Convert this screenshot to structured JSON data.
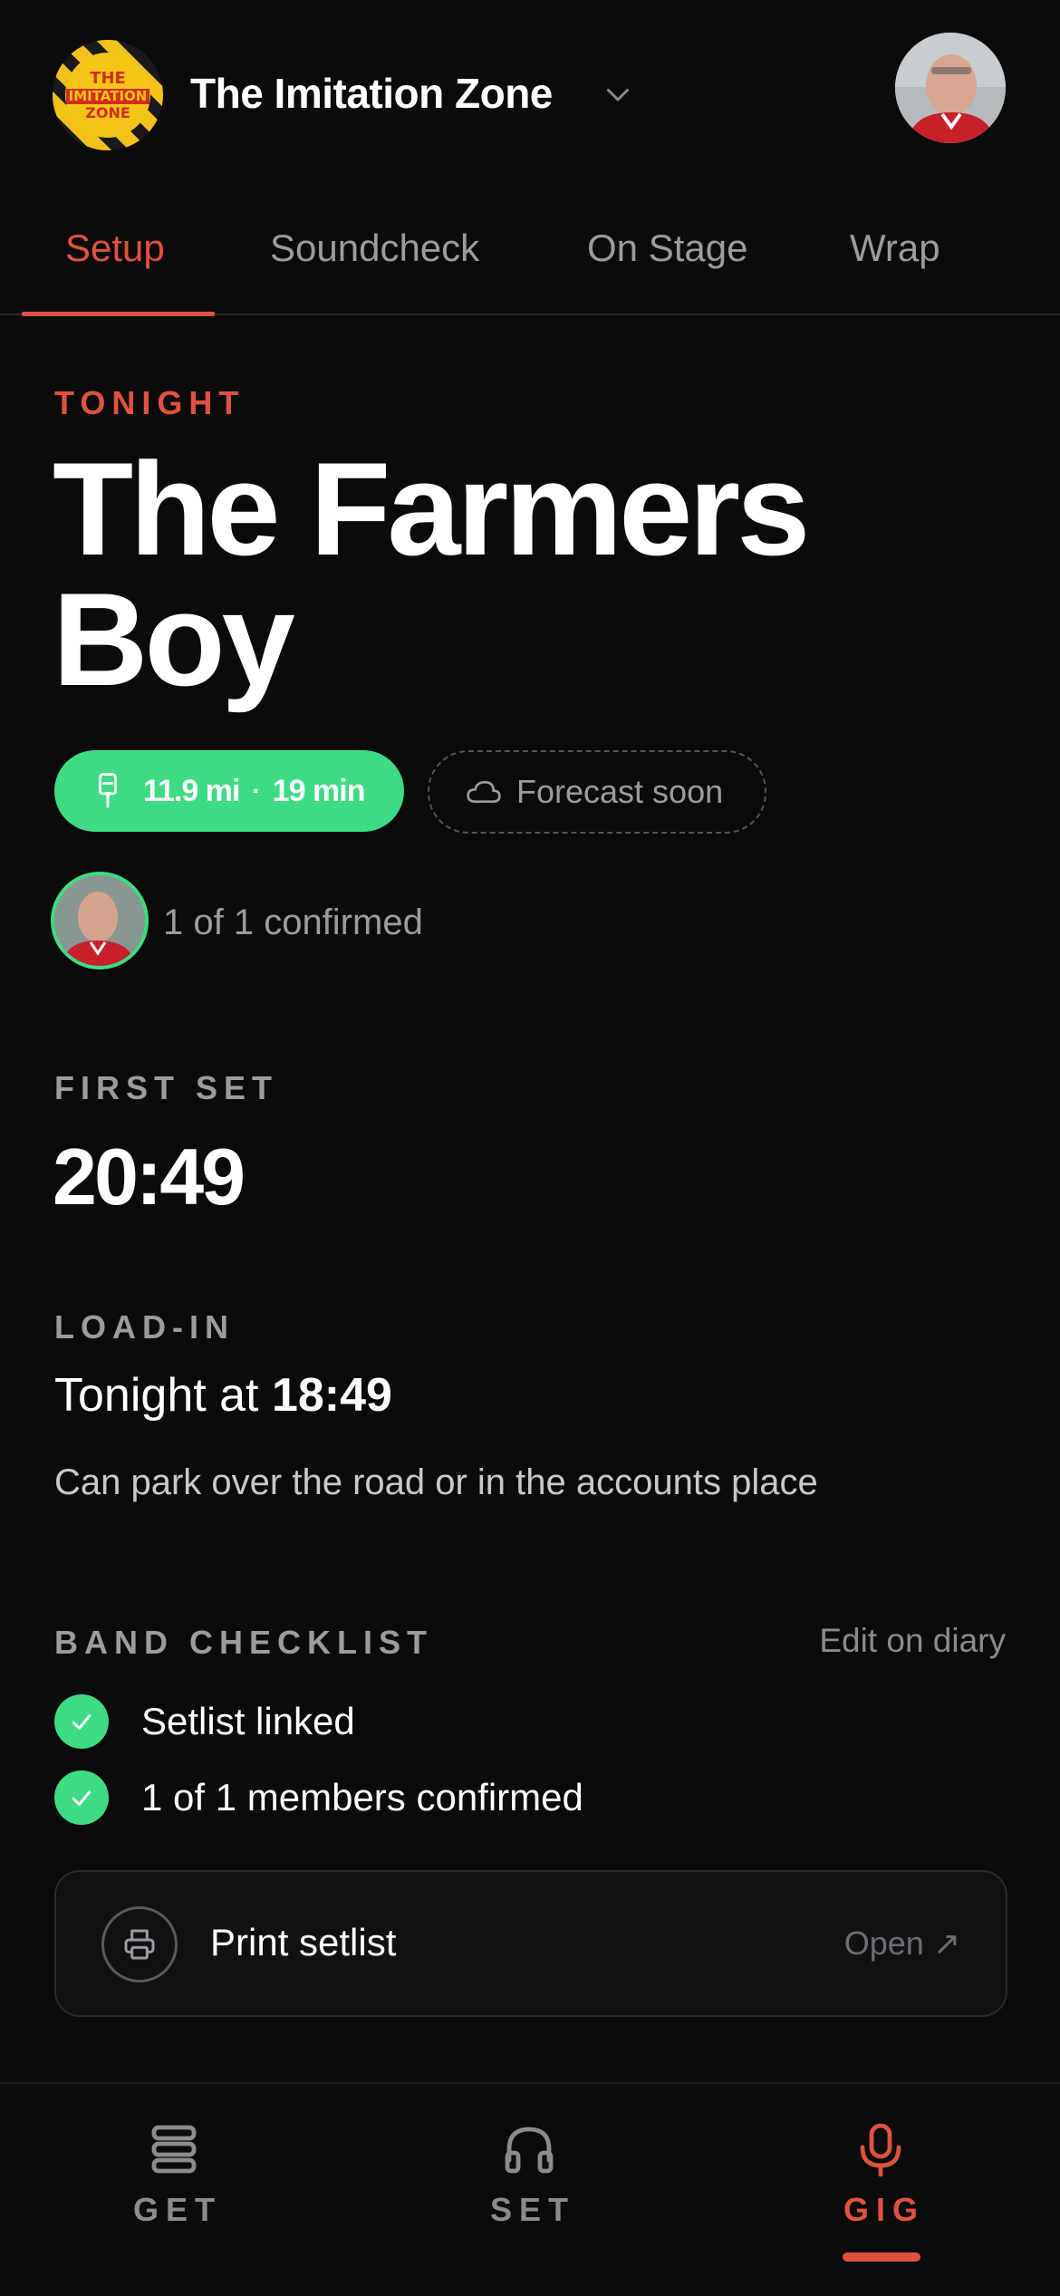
{
  "header": {
    "band_name": "The Imitation Zone",
    "logo_text": [
      "THE",
      "IMITATION",
      "ZONE"
    ],
    "logo_icon": "band-logo",
    "switcher_icon": "chevron-down-icon",
    "avatar_icon": "user-avatar"
  },
  "tabs": [
    {
      "label": "Setup",
      "active": true
    },
    {
      "label": "Soundcheck",
      "active": false
    },
    {
      "label": "On Stage",
      "active": false
    },
    {
      "label": "Wrap",
      "active": false
    }
  ],
  "gig": {
    "eyebrow": "TONIGHT",
    "venue": "The Farmers Boy",
    "travel": {
      "distance": "11.9 mi",
      "separator": "·",
      "duration": "19 min",
      "icon": "car-icon"
    },
    "forecast": {
      "label": "Forecast soon",
      "icon": "cloud-icon"
    },
    "confirmed": "1 of 1 confirmed",
    "first_set": {
      "label": "FIRST SET",
      "time": "20:49"
    },
    "load_in": {
      "label": "LOAD-IN",
      "prefix": "Tonight at",
      "time": "18:49",
      "note": "Can park over the road or in the accounts place"
    }
  },
  "checklist": {
    "title": "BAND CHECKLIST",
    "edit_label": "Edit on diary",
    "items": [
      {
        "label": "Setlist linked",
        "done": true
      },
      {
        "label": "1 of 1 members confirmed",
        "done": true
      }
    ]
  },
  "print": {
    "label": "Print setlist",
    "action": "Open ↗",
    "icon": "printer-icon"
  },
  "bottom_nav": [
    {
      "label": "GET",
      "icon": "stack-icon",
      "active": false
    },
    {
      "label": "SET",
      "icon": "headphones-icon",
      "active": false
    },
    {
      "label": "GIG",
      "icon": "microphone-icon",
      "active": true
    }
  ],
  "colors": {
    "background": "#0b0b0c",
    "accent": "#e0523f",
    "success": "#3ddc84",
    "muted": "#9c9ca0"
  }
}
